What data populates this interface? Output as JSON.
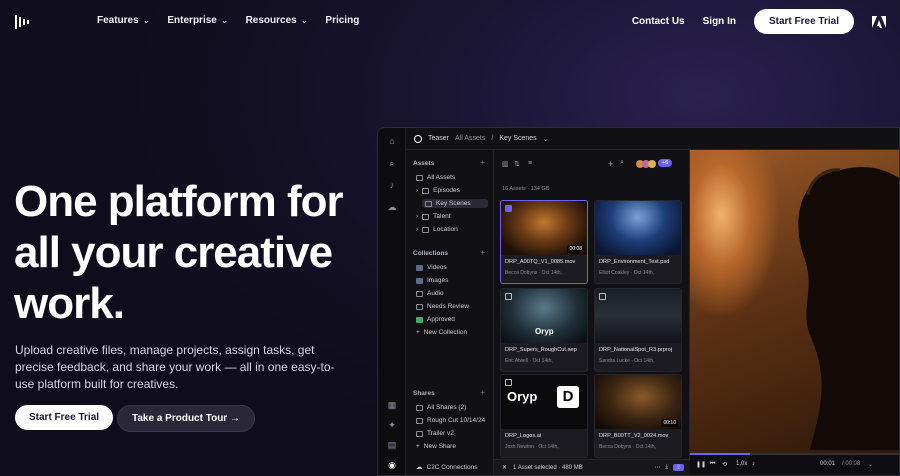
{
  "nav": {
    "links": [
      {
        "label": "Features",
        "has_dropdown": true
      },
      {
        "label": "Enterprise",
        "has_dropdown": true
      },
      {
        "label": "Resources",
        "has_dropdown": true
      },
      {
        "label": "Pricing",
        "has_dropdown": false
      }
    ],
    "contact": "Contact Us",
    "sign_in": "Sign In",
    "cta": "Start Free Trial",
    "logo_icon": "frameio-logo-icon",
    "adobe_icon": "adobe-logo-icon"
  },
  "hero": {
    "headline": "One platform for all your creative work.",
    "subcopy": "Upload creative files, manage projects, assign tasks, get precise feedback, and share your work — all in one easy-to-use platform built for creatives.",
    "cta_primary": "Start Free Trial",
    "cta_secondary": "Take a Product Tour →"
  },
  "app": {
    "breadcrumb": {
      "project": "Teaser",
      "root": "All Assets",
      "current": "Key Scenes"
    },
    "sidebar": {
      "assets_title": "Assets",
      "assets": [
        "All Assets",
        "Episodes",
        "Key Scenes",
        "Talent",
        "Location"
      ],
      "collections_title": "Collections",
      "collections": [
        "Videos",
        "Images",
        "Audio",
        "Needs Review",
        "Approved",
        "New Collection"
      ],
      "shares_title": "Shares",
      "shares": [
        "All Shares (2)",
        "Rough Cut 10/14/24",
        "Trailer v2",
        "New Share"
      ],
      "footer": "C2C Connections"
    },
    "grid": {
      "count": "16 Assets · 134 GB",
      "cards": [
        {
          "name": "DRP_A00TQ_V1_0085.mov",
          "meta": "Becca Dobyns · Oct 14th,",
          "duration": "00:08",
          "selected": true
        },
        {
          "name": "DRP_Environment_Test.psd",
          "meta": "Elliot Coakley · Oct 14th,",
          "duration": "",
          "selected": false
        },
        {
          "name": "DRP_Supers_RoughCut.aep",
          "meta": "Eric Atwell · Oct 14th,",
          "duration": "",
          "selected": false
        },
        {
          "name": "DRP_NationalSpot_R3.prproj",
          "meta": "Sandra Lucke · Oct 14th,",
          "duration": "",
          "selected": false
        },
        {
          "name": "DRP_Logos.ai",
          "meta": "Josh Newton · Oct 14th,",
          "duration": "",
          "selected": false
        },
        {
          "name": "DRP_B00TT_V2_0024.mov",
          "meta": "Becca Dobyns · Oct 14th,",
          "duration": "00:10",
          "selected": false
        }
      ],
      "selection_bar": "1 Asset selected · 480 MB",
      "thumb_text_oryp": "Oryp",
      "thumb_text_d": "D"
    },
    "viewer": {
      "speed": "1.0x",
      "timecode": "00:01",
      "duration": "/ 00:08"
    },
    "avatar_badge": "+6"
  },
  "colors": {
    "accent": "#6e62f0",
    "bg": "#120f22"
  }
}
